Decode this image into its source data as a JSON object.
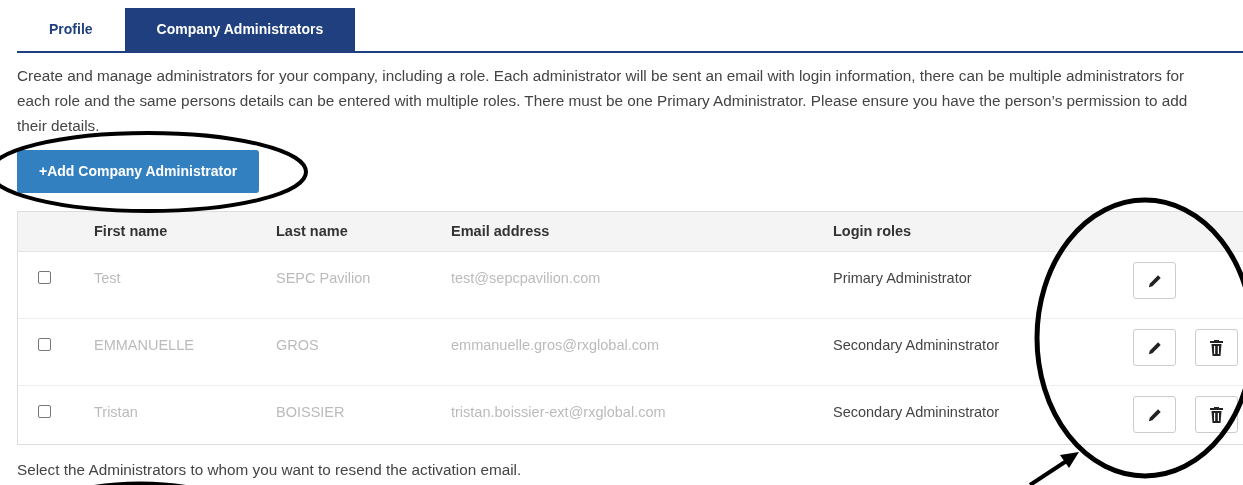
{
  "tabs": [
    {
      "label": "Profile",
      "selected": false
    },
    {
      "label": "Company Administrators",
      "selected": true
    }
  ],
  "intro": "Create and manage administrators for your company, including a role. Each administrator will be sent an email with login information, there can be multiple administrators for each role and the same persons details can be entered with multiple roles. There must be one Primary Administrator. Please ensure you have the person’s permission to add their details.",
  "add_button": "+Add Company Administrator",
  "table": {
    "columns": [
      "First name",
      "Last name",
      "Email address",
      "Login roles"
    ],
    "rows": [
      {
        "checked": false,
        "first_name": "Test",
        "last_name": "SEPC Pavilion",
        "email": "test@sepcpavilion.com",
        "role": "Primary Administrator",
        "deletable": false
      },
      {
        "checked": false,
        "first_name": "EMMANUELLE",
        "last_name": "GROS",
        "email": "emmanuelle.gros@rxglobal.com",
        "role": "Secondary Admininstrator",
        "deletable": true
      },
      {
        "checked": false,
        "first_name": "Tristan",
        "last_name": "BOISSIER",
        "email": "tristan.boissier-ext@rxglobal.com",
        "role": "Secondary Admininstrator",
        "deletable": true
      }
    ]
  },
  "footer_note": "Select the Administrators to whom you want to resend the activation email."
}
